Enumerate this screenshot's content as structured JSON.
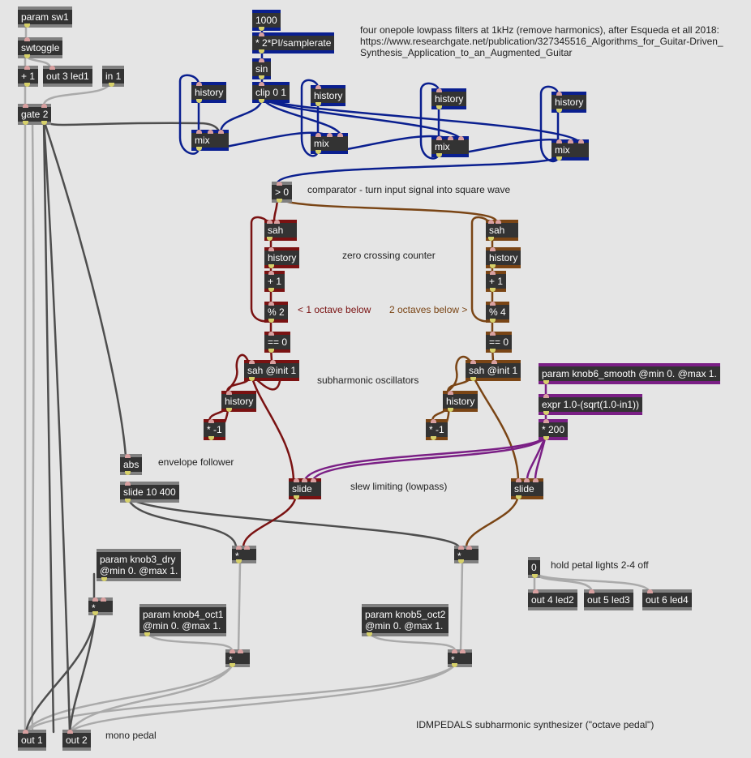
{
  "patcher": {
    "title": "IDMPEDALS subharmonic synthesizer (\"octave pedal\")",
    "colors": {
      "background": "#e5e5e5",
      "box": "#333333",
      "cord_gray": "#5a5a5a",
      "cord_light": "#aaaaaa",
      "filter_blue": "#0a1f8f",
      "octave1_red": "#7a1212",
      "octave2_brown": "#7a4515",
      "smooth_purple": "#7a1f85"
    }
  },
  "objects": {
    "param_sw1": "param sw1",
    "swtoggle": "swtoggle",
    "plus1_top": "+ 1",
    "out3": "out 3 led1",
    "in1": "in 1",
    "gate2": "gate 2",
    "const1000": "1000",
    "mul2pi": "* 2*PI/samplerate",
    "sin": "sin",
    "clip": "clip 0 1",
    "history_f1": "history",
    "history_f2": "history",
    "history_f3": "history",
    "history_f4": "history",
    "mix1": "mix",
    "mix2": "mix",
    "mix3": "mix",
    "mix4": "mix",
    "gt0": "> 0",
    "sah_a": "sah",
    "history_a": "history",
    "plus1_a": "+ 1",
    "mod2": "% 2",
    "eq0_a": "== 0",
    "sahinit_a": "sah @init 1",
    "history_osc_a": "history",
    "neg_a": "* -1",
    "slide_a": "slide",
    "sah_b": "sah",
    "history_b": "history",
    "plus1_b": "+ 1",
    "mod4": "% 4",
    "eq0_b": "== 0",
    "sahinit_b": "sah @init 1",
    "history_osc_b": "history",
    "neg_b": "* -1",
    "slide_b": "slide",
    "param_knob6": "param knob6_smooth @min 0. @max 1.",
    "expr": "expr 1.0-(sqrt(1.0-in1))",
    "mul200": "* 200",
    "abs": "abs",
    "slide_env": "slide 10 400",
    "mul_a": "*",
    "mul_b": "*",
    "param_knob3": "param knob3_dry\n@min 0. @max 1.",
    "mul_dry": "*",
    "param_knob4": "param knob4_oct1\n@min 0. @max 1.",
    "mul_oct1": "*",
    "param_knob5": "param knob5_oct2\n@min 0. @max 1.",
    "mul_oct2": "*",
    "zero": "0",
    "out4": "out 4 led2",
    "out5": "out 5 led3",
    "out6": "out 6 led4",
    "out1": "out 1",
    "out2": "out 2"
  },
  "comments": {
    "filters": "four onepole lowpass filters at 1kHz (remove harmonics), after Esqueda et all 2018:\nhttps://www.researchgate.net/publication/327345516_Algorithms_for_Guitar-Driven_\nSynthesis_Application_to_an_Augmented_Guitar",
    "comparator": "comparator - turn input signal into square wave",
    "zero_crossing": "zero crossing counter",
    "one_octave": "< 1 octave below",
    "two_octaves": "2 octaves below >",
    "subharmonic": "subharmonic oscillators",
    "envelope": "envelope follower",
    "slew": "slew limiting (lowpass)",
    "hold_lights": "hold petal lights 2-4 off",
    "mono": "mono pedal",
    "title": "IDMPEDALS subharmonic synthesizer (\"octave pedal\")"
  }
}
